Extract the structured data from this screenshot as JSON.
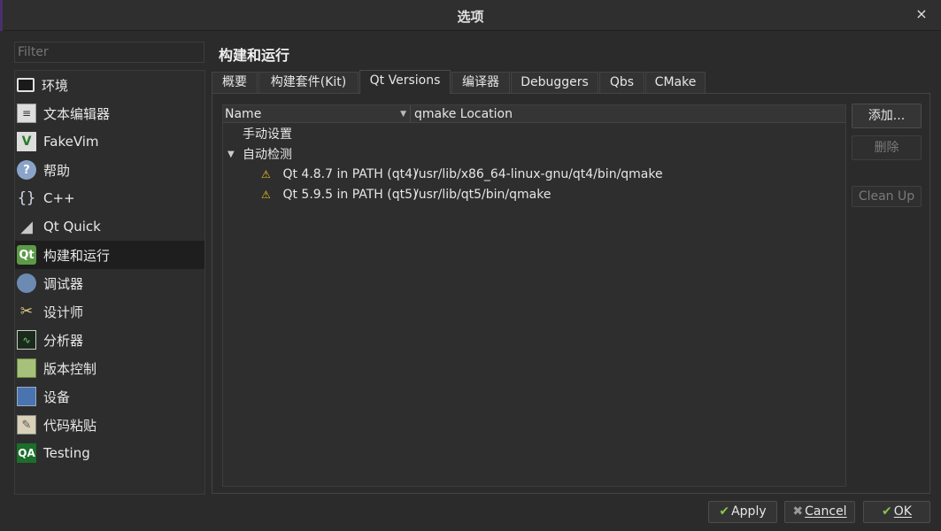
{
  "window": {
    "title": "选项",
    "close_icon": "×"
  },
  "filter": {
    "placeholder": "Filter",
    "value": ""
  },
  "sidebar": {
    "items": [
      {
        "label": "环境",
        "icon": "monitor-icon",
        "glyph": ""
      },
      {
        "label": "文本编辑器",
        "icon": "text-document-icon",
        "glyph": "≡"
      },
      {
        "label": "FakeVim",
        "icon": "vim-icon",
        "glyph": "V"
      },
      {
        "label": "帮助",
        "icon": "help-icon",
        "glyph": "?"
      },
      {
        "label": "C++",
        "icon": "braces-icon",
        "glyph": "{}"
      },
      {
        "label": "Qt Quick",
        "icon": "paper-plane-icon",
        "glyph": "◢"
      },
      {
        "label": "构建和运行",
        "icon": "qt-build-icon",
        "glyph": "Qt"
      },
      {
        "label": "调试器",
        "icon": "debugger-icon",
        "glyph": ""
      },
      {
        "label": "设计师",
        "icon": "designer-tools-icon",
        "glyph": "✂"
      },
      {
        "label": "分析器",
        "icon": "analyzer-icon",
        "glyph": "∿"
      },
      {
        "label": "版本控制",
        "icon": "version-control-icon",
        "glyph": ""
      },
      {
        "label": "设备",
        "icon": "device-icon",
        "glyph": ""
      },
      {
        "label": "代码粘贴",
        "icon": "clipboard-icon",
        "glyph": "✎"
      },
      {
        "label": "Testing",
        "icon": "qa-icon",
        "glyph": "QA"
      }
    ],
    "active_index": 6
  },
  "page": {
    "title": "构建和运行"
  },
  "tabs": [
    "概要",
    "构建套件(Kit)",
    "Qt Versions",
    "编译器",
    "Debuggers",
    "Qbs",
    "CMake"
  ],
  "active_tab": 2,
  "tree": {
    "columns": {
      "name": "Name",
      "location": "qmake Location"
    },
    "groups": [
      {
        "label": "手动设置",
        "items": []
      },
      {
        "label": "自动检测",
        "items": [
          {
            "name": "Qt 4.8.7 in PATH (qt4)",
            "location": "/usr/lib/x86_64-linux-gnu/qt4/bin/qmake"
          },
          {
            "name": "Qt 5.9.5 in PATH (qt5)",
            "location": "/usr/lib/qt5/bin/qmake"
          }
        ]
      }
    ]
  },
  "side_buttons": {
    "add": "添加...",
    "remove": "删除",
    "cleanup": "Clean Up"
  },
  "bottom_buttons": {
    "apply": "Apply",
    "cancel": "Cancel",
    "ok": "OK"
  },
  "colors": {
    "accent_green": "#8bc34a",
    "warning": "#f0c020",
    "active_item_bg": "#1e1e1e"
  }
}
